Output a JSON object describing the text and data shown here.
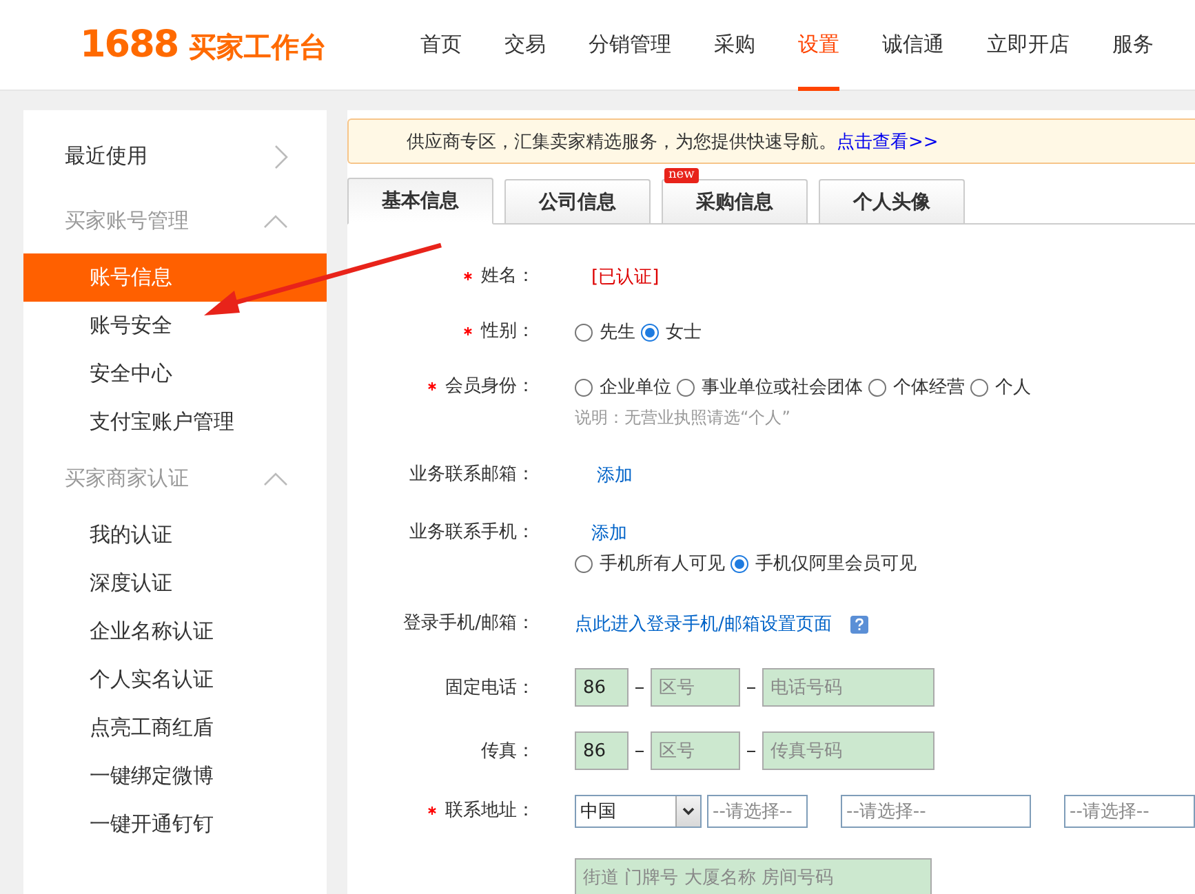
{
  "header": {
    "logo_number": "1688",
    "logo_text": "买家工作台",
    "nav": [
      {
        "label": "首页",
        "selected": false
      },
      {
        "label": "交易",
        "selected": false
      },
      {
        "label": "分销管理",
        "selected": false
      },
      {
        "label": "采购",
        "selected": false
      },
      {
        "label": "设置",
        "selected": true
      },
      {
        "label": "诚信通",
        "selected": false
      },
      {
        "label": "立即开店",
        "selected": false
      },
      {
        "label": "服务",
        "selected": false
      }
    ]
  },
  "sidebar": {
    "items": [
      {
        "kind": "link",
        "label": "最近使用",
        "expanded": false
      },
      {
        "kind": "group",
        "label": "买家账号管理",
        "expanded": true,
        "children": [
          {
            "label": "账号信息",
            "selected": true
          },
          {
            "label": "账号安全",
            "selected": false
          },
          {
            "label": "安全中心",
            "selected": false
          },
          {
            "label": "支付宝账户管理",
            "selected": false
          }
        ]
      },
      {
        "kind": "group",
        "label": "买家商家认证",
        "expanded": true,
        "children": [
          {
            "label": "我的认证",
            "selected": false
          },
          {
            "label": "深度认证",
            "selected": false
          },
          {
            "label": "企业名称认证",
            "selected": false
          },
          {
            "label": "个人实名认证",
            "selected": false
          },
          {
            "label": "点亮工商红盾",
            "selected": false
          },
          {
            "label": "一键绑定微博",
            "selected": false
          },
          {
            "label": "一键开通钉钉",
            "selected": false
          }
        ]
      }
    ]
  },
  "notice": {
    "text": "供应商专区，汇集卖家精选服务，为您提供快速导航。",
    "link": "点击查看>>"
  },
  "tabs": [
    {
      "label": "基本信息",
      "selected": true
    },
    {
      "label": "公司信息",
      "selected": false
    },
    {
      "label": "采购信息",
      "selected": false,
      "badge": "new"
    },
    {
      "label": "个人头像",
      "selected": false
    }
  ],
  "form": [
    {
      "kind": "status",
      "required": true,
      "label": "姓名：",
      "value": "[已认证]"
    },
    {
      "kind": "radios",
      "required": true,
      "label": "性别：",
      "options": [
        {
          "label": "先生",
          "selected": false
        },
        {
          "label": "女士",
          "selected": true
        }
      ]
    },
    {
      "kind": "radios",
      "required": true,
      "label": "会员身份：",
      "options": [
        {
          "label": "企业单位",
          "selected": false
        },
        {
          "label": "事业单位或社会团体",
          "selected": false
        },
        {
          "label": "个体经营",
          "selected": false
        },
        {
          "label": "个人",
          "selected": false
        }
      ],
      "note": "说明：无营业执照请选“个人”"
    },
    {
      "kind": "link",
      "required": false,
      "label": "业务联系邮箱：",
      "link": "添加"
    },
    {
      "kind": "link",
      "required": false,
      "label": "业务联系手机：",
      "link": "添加",
      "options": [
        {
          "label": "手机所有人可见",
          "selected": false
        },
        {
          "label": "手机仅阿里会员可见",
          "selected": true
        }
      ]
    },
    {
      "kind": "help_link",
      "required": false,
      "label": "登录手机/邮箱：",
      "link": "点此进入登录手机/邮箱设置页面"
    },
    {
      "kind": "phone",
      "required": false,
      "label": "固定电话：",
      "country": "86",
      "area_placeholder": "区号",
      "number_placeholder": "电话号码"
    },
    {
      "kind": "phone",
      "required": false,
      "label": "传真：",
      "country": "86",
      "area_placeholder": "区号",
      "number_placeholder": "传真号码"
    },
    {
      "kind": "address",
      "required": true,
      "label": "联系地址：",
      "country": "中国",
      "selects": [
        "--请选择--",
        "--请选择--",
        "--请选择--"
      ],
      "street_placeholder": "街道 门牌号 大厦名称 房间号码"
    }
  ]
}
